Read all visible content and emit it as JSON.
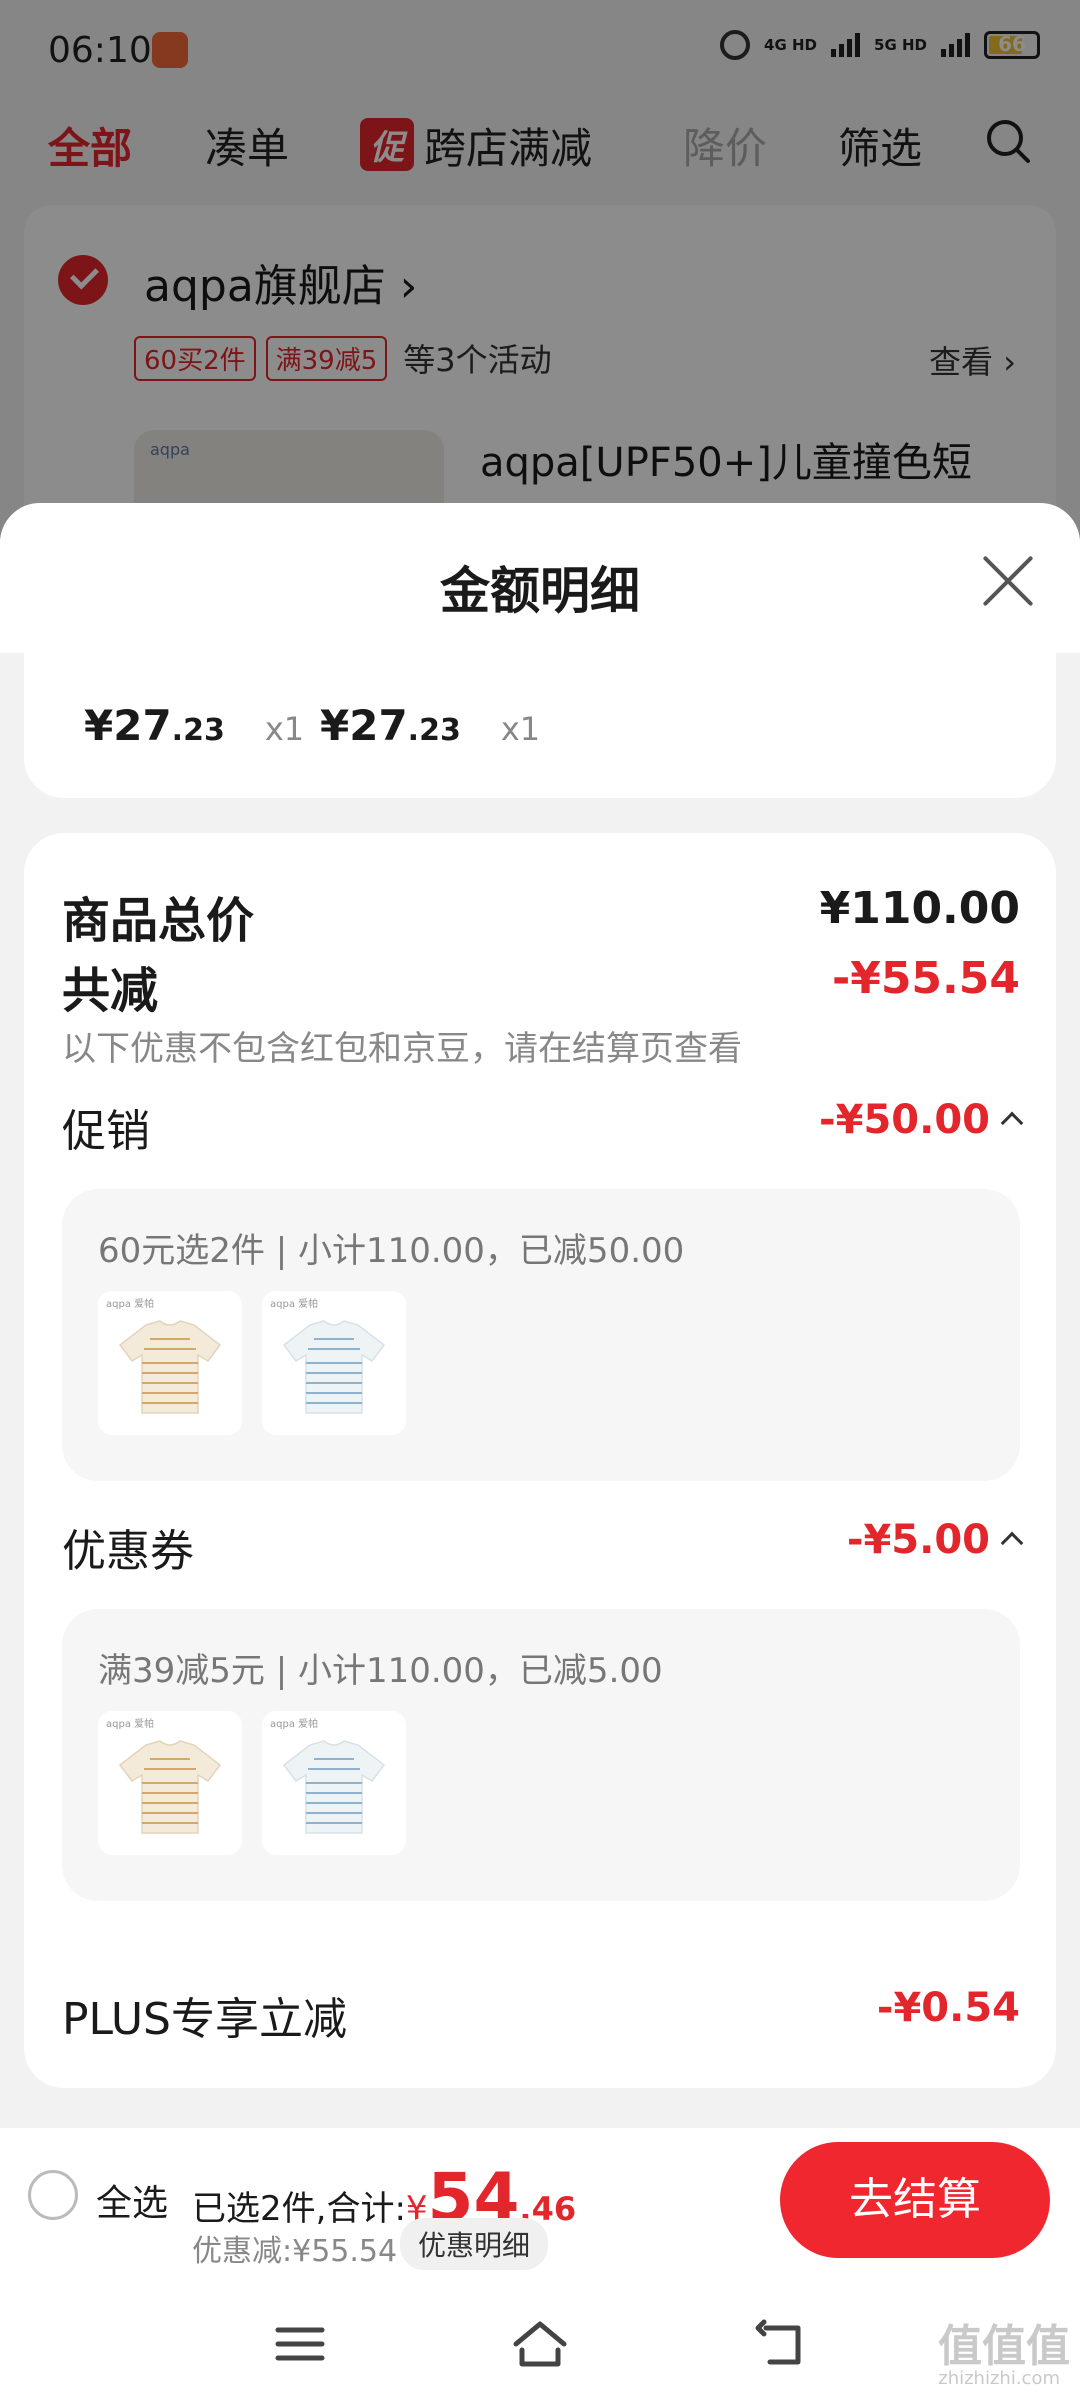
{
  "status_bar": {
    "time": "06:10",
    "net_4g": "4G HD",
    "net_5g": "5G HD",
    "battery": "66"
  },
  "top_nav": {
    "tabs": [
      "全部",
      "凑单",
      "跨店满减",
      "降价",
      "筛选"
    ],
    "promo_badge": "促"
  },
  "store": {
    "name": "aqpa旗舰店 ›",
    "tags": [
      "60买2件",
      "满39减5"
    ],
    "tags_extra": "等3个活动",
    "view_label": "查看 ›",
    "product_title": "aqpa[UPF50+]儿童撞色短",
    "thumb_logo": "aqpa"
  },
  "sheet": {
    "title": "金额明细",
    "items": [
      {
        "price_int": "¥27",
        "price_dec": ".23",
        "qty": "x1"
      },
      {
        "price_int": "¥27",
        "price_dec": ".23",
        "qty": "x1"
      }
    ],
    "total_label": "商品总价",
    "total_value": "¥110.00",
    "reduced_label": "共减",
    "reduced_value": "-¥55.54",
    "hint": "以下优惠不包含红包和京豆，请在结算页查看",
    "promotion": {
      "label": "促销",
      "value": "-¥50.00",
      "detail": "60元选2件 | 小计110.00，已减50.00"
    },
    "coupon": {
      "label": "优惠券",
      "value": "-¥5.00",
      "detail": "满39减5元 | 小计110.00，已减5.00"
    },
    "plus": {
      "label": "PLUS专享立减",
      "value": "-¥0.54"
    },
    "thumb_logo": "aqpa 爱帕"
  },
  "bottom_bar": {
    "select_all": "全选",
    "selected_prefix": "已选2件,合计:",
    "total_yen": "¥",
    "total_int": "54",
    "total_dec": ".46",
    "discount": "优惠减:¥55.54",
    "detail_chip": "优惠明细",
    "checkout": "去结算"
  },
  "watermark": {
    "main": "值值值",
    "sub": "zhizhizhi.com"
  },
  "colors": {
    "accent_red": "#e3262b",
    "checkout_red": "#f0272f",
    "muted_text": "#888888"
  }
}
